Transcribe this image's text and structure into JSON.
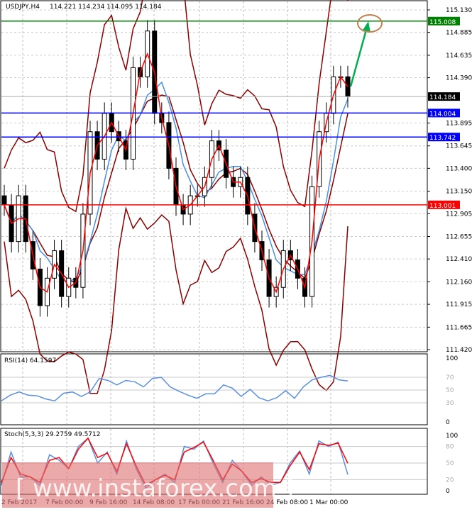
{
  "header": {
    "symbol_label": "USDJPY,H4",
    "ohlc": "114.221 114.234 114.095 114.184"
  },
  "colors": {
    "up": "#ffffff",
    "down": "#000000",
    "ma_fast": "#ff0000",
    "ma_slow": "#4a90e2",
    "bands": "#8b0000",
    "support_blue": "#0000ff",
    "level_red": "#ff0000",
    "level_green": "#008000",
    "arrow": "#00b050",
    "circle": "#c08050",
    "rsi": "#5b8fe0",
    "stoch_main": "#5b8fe0",
    "stoch_signal": "#ff0000"
  },
  "chart_data": [
    {
      "type": "candlestick",
      "title": "USDJPY,H4",
      "ylim": [
        111.42,
        115.13
      ],
      "y_ticks": [
        "115.130",
        "114.885",
        "114.635",
        "114.390",
        "113.895",
        "113.645",
        "113.400",
        "113.150",
        "112.905",
        "112.655",
        "112.410",
        "112.160",
        "111.915",
        "111.665",
        "111.420"
      ],
      "x_ticks": [
        "2 Feb 2017",
        "7 Feb 00:00",
        "9 Feb 16:00",
        "14 Feb 08:00",
        "17 Feb 00:00",
        "21 Feb 16:00",
        "24 Feb 08:00",
        "1 Mar 00:00"
      ],
      "closes": [
        113.0,
        112.6,
        113.1,
        112.6,
        112.3,
        111.9,
        112.2,
        112.5,
        112.0,
        112.2,
        112.1,
        112.9,
        113.8,
        113.5,
        114.0,
        113.8,
        113.7,
        113.5,
        114.5,
        114.4,
        114.9,
        114.0,
        113.9,
        113.4,
        113.0,
        112.9,
        113.1,
        113.1,
        113.3,
        113.7,
        113.6,
        113.3,
        113.2,
        113.3,
        112.9,
        112.6,
        112.4,
        112.0,
        112.1,
        112.5,
        112.4,
        112.2,
        112.0,
        113.2,
        113.8,
        114.0,
        114.4,
        114.4,
        114.184
      ],
      "levels": [
        {
          "value": 115.008,
          "label": "115.008",
          "color": "#008000"
        },
        {
          "value": 114.004,
          "label": "114.004",
          "color": "#0000ff"
        },
        {
          "value": 113.742,
          "label": "113.742",
          "color": "#0000ff"
        },
        {
          "value": 113.001,
          "label": "113.001",
          "color": "#ff0000"
        }
      ],
      "current_price": {
        "value": 114.184,
        "label": "114.184"
      }
    },
    {
      "type": "line",
      "title": "RSI(14) 64.1597",
      "ylim": [
        0,
        100
      ],
      "y_ticks": [
        "100",
        "70",
        "50",
        "30",
        "0"
      ],
      "levels": [
        70,
        50,
        30
      ],
      "values": [
        33,
        42,
        47,
        42,
        41,
        36,
        33,
        45,
        47,
        40,
        47,
        68,
        65,
        58,
        65,
        63,
        55,
        68,
        70,
        55,
        48,
        42,
        37,
        44,
        44,
        58,
        53,
        40,
        51,
        38,
        33,
        38,
        49,
        37,
        55,
        66,
        70,
        73,
        66,
        64.16
      ]
    },
    {
      "type": "line",
      "title": "Stoch(5,3,3) 29.2759 49.5712",
      "ylim": [
        0,
        100
      ],
      "y_ticks": [
        "100",
        "80",
        "50",
        "20",
        "0"
      ],
      "levels": [
        80,
        50,
        20
      ],
      "series": [
        {
          "values": [
            10,
            70,
            25,
            25,
            10,
            65,
            55,
            40,
            80,
            95,
            50,
            70,
            30,
            90,
            40,
            5,
            20,
            30,
            15,
            80,
            75,
            90,
            50,
            15,
            55,
            35,
            10,
            25,
            10,
            15,
            50,
            72,
            30,
            90,
            80,
            88,
            29.28
          ]
        },
        {
          "values": [
            15,
            60,
            30,
            25,
            15,
            55,
            60,
            40,
            75,
            95,
            60,
            68,
            35,
            85,
            45,
            10,
            20,
            28,
            20,
            70,
            78,
            88,
            55,
            20,
            48,
            35,
            15,
            22,
            15,
            15,
            45,
            70,
            38,
            85,
            82,
            86,
            49.57
          ]
        }
      ]
    }
  ],
  "watermark": "www.instaforex.com"
}
